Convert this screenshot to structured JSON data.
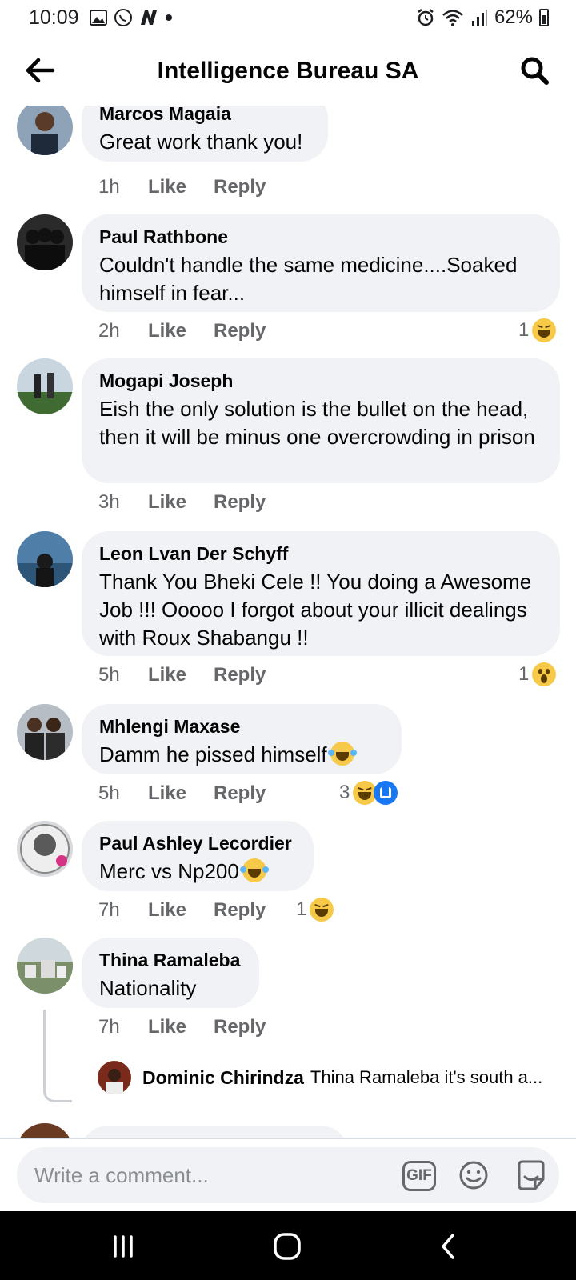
{
  "status_bar": {
    "time": "10:09",
    "battery": "62%"
  },
  "header": {
    "title": "Intelligence Bureau SA"
  },
  "comments": [
    {
      "author": "Marcos Magaia",
      "text": "Great work thank you!",
      "time": "1h",
      "like": "Like",
      "reply": "Reply"
    },
    {
      "author": "Paul Rathbone",
      "text": "Couldn't handle the same medicine....Soaked himself in fear...",
      "time": "2h",
      "like": "Like",
      "reply": "Reply",
      "reaction_count": "1"
    },
    {
      "author": "Mogapi Joseph",
      "text": "Eish the only solution is the bullet on the head, then it will be minus one overcrowding in prison",
      "time": "3h",
      "like": "Like",
      "reply": "Reply"
    },
    {
      "author": "Leon Lvan Der Schyff",
      "text": "Thank You Bheki Cele !! You doing a Awesome Job !!! Ooooo I forgot about your illicit dealings with Roux Shabangu !!",
      "time": "5h",
      "like": "Like",
      "reply": "Reply",
      "reaction_count": "1"
    },
    {
      "author": "Mhlengi Maxase",
      "text": "Damm he pissed himself",
      "time": "5h",
      "like": "Like",
      "reply": "Reply",
      "reaction_count": "3"
    },
    {
      "author": "Paul Ashley Lecordier",
      "text": "Merc vs Np200",
      "time": "7h",
      "like": "Like",
      "reply": "Reply",
      "reaction_count": "1"
    },
    {
      "author": "Thina Ramaleba",
      "text": "Nationality",
      "time": "7h",
      "like": "Like",
      "reply": "Reply"
    }
  ],
  "reply_preview": {
    "author": "Dominic Chirindza",
    "text": "Thina Ramaleba it's south a..."
  },
  "composer": {
    "placeholder": "Write a comment...",
    "gif_label": "GIF"
  },
  "colors": {
    "bubble": "#f0f2f5",
    "meta_text": "#65676b",
    "like_blue": "#1877f2"
  }
}
